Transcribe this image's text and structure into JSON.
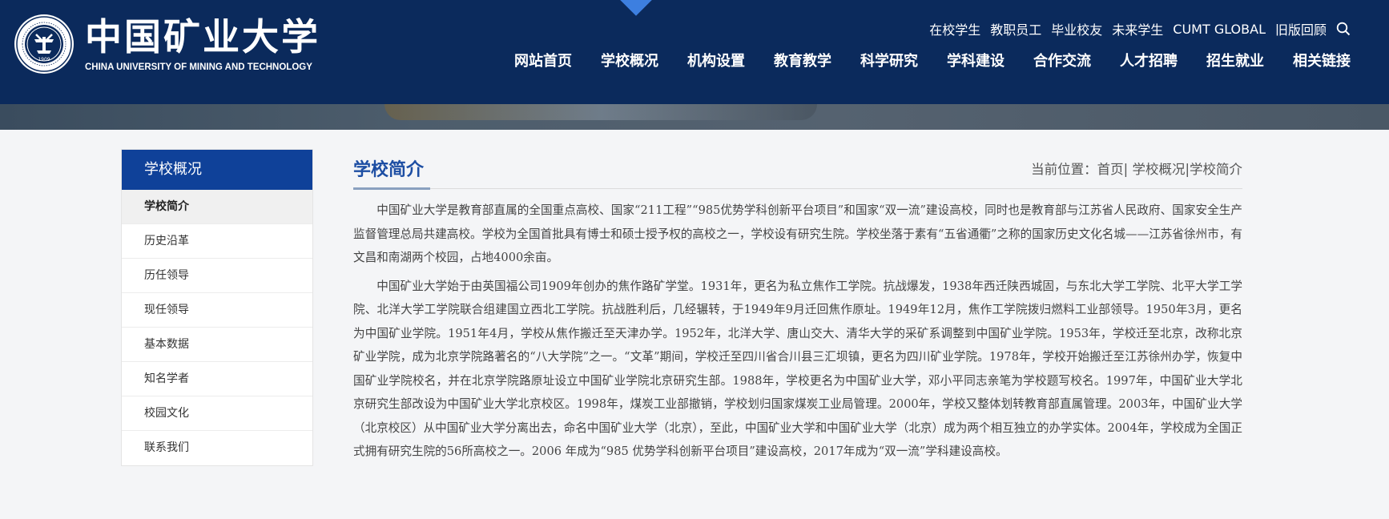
{
  "brand": {
    "name_cn": "中国矿业大学",
    "name_en": "CHINA UNIVERSITY OF MINING AND TECHNOLOGY",
    "logo_year": "1909"
  },
  "top_links": [
    "在校学生",
    "教职员工",
    "毕业校友",
    "未来学生",
    "CUMT GLOBAL",
    "旧版回顾"
  ],
  "nav": [
    "网站首页",
    "学校概况",
    "机构设置",
    "教育教学",
    "科学研究",
    "学科建设",
    "合作交流",
    "人才招聘",
    "招生就业",
    "相关链接"
  ],
  "sidebar": {
    "title": "学校概况",
    "items": [
      "学校简介",
      "历史沿革",
      "历任领导",
      "现任领导",
      "基本数据",
      "知名学者",
      "校园文化",
      "联系我们"
    ],
    "active_index": 0
  },
  "content": {
    "title": "学校简介",
    "breadcrumb": {
      "prefix": "当前位置：",
      "home": "首页",
      "sep": "|",
      "section": "学校概况",
      "current": "学校简介"
    },
    "paragraphs": [
      "中国矿业大学是教育部直属的全国重点高校、国家“211工程”“985优势学科创新平台项目”和国家“双一流”建设高校，同时也是教育部与江苏省人民政府、国家安全生产监督管理总局共建高校。学校为全国首批具有博士和硕士授予权的高校之一，学校设有研究生院。学校坐落于素有“五省通衢”之称的国家历史文化名城——江苏省徐州市，有文昌和南湖两个校园，占地4000余亩。",
      "中国矿业大学始于由英国福公司1909年创办的焦作路矿学堂。1931年，更名为私立焦作工学院。抗战爆发，1938年西迁陕西城固，与东北大学工学院、北平大学工学院、北洋大学工学院联合组建国立西北工学院。抗战胜利后，几经辗转，于1949年9月迁回焦作原址。1949年12月，焦作工学院拨归燃料工业部领导。1950年3月，更名为中国矿业学院。1951年4月，学校从焦作搬迁至天津办学。1952年，北洋大学、唐山交大、清华大学的采矿系调整到中国矿业学院。1953年，学校迁至北京，改称北京矿业学院，成为北京学院路著名的“八大学院”之一。“文革”期间，学校迁至四川省合川县三汇坝镇，更名为四川矿业学院。1978年，学校开始搬迁至江苏徐州办学，恢复中国矿业学院校名，并在北京学院路原址设立中国矿业学院北京研究生部。1988年，学校更名为中国矿业大学，邓小平同志亲笔为学校题写校名。1997年，中国矿业大学北京研究生部改设为中国矿业大学北京校区。1998年，煤炭工业部撤销，学校划归国家煤炭工业局管理。2000年，学校又整体划转教育部直属管理。2003年，中国矿业大学（北京校区）从中国矿业大学分离出去，命名中国矿业大学（北京），至此，中国矿业大学和中国矿业大学（北京）成为两个相互独立的办学实体。2004年，学校成为全国正式拥有研究生院的56所高校之一。2006 年成为“985 优势学科创新平台项目”建设高校，2017年成为“双一流”学科建设高校。"
    ]
  },
  "colors": {
    "header_bg": "#0b2a5c",
    "sidebar_title_bg": "#0f4199",
    "content_title": "#1d4ea3",
    "diamond": "#3d7fe0"
  },
  "icons": {
    "search": "search-icon",
    "logo": "university-seal-icon"
  }
}
